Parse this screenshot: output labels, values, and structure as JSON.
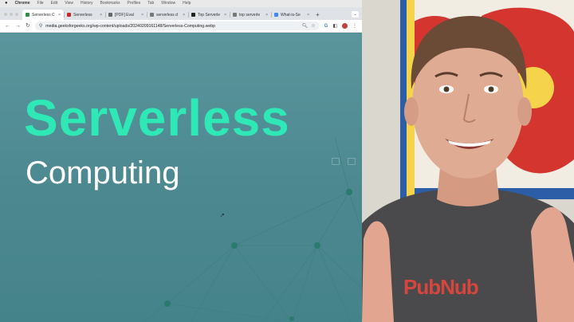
{
  "menubar": {
    "app": "Chrome",
    "items": [
      "File",
      "Edit",
      "View",
      "History",
      "Bookmarks",
      "Profiles",
      "Tab",
      "Window",
      "Help"
    ]
  },
  "tabs": [
    {
      "label": "Serverless C",
      "color": "#2f8d46",
      "active": true
    },
    {
      "label": "Serverless",
      "color": "#c62828",
      "active": false
    },
    {
      "label": "[PDF] Eval",
      "color": "#666666",
      "active": false
    },
    {
      "label": "serverless d",
      "color": "#777777",
      "active": false
    },
    {
      "label": "Top Serverle",
      "color": "#222222",
      "active": false
    },
    {
      "label": "top serverle",
      "color": "#777777",
      "active": false
    },
    {
      "label": "What-is-Se",
      "color": "#4285f4",
      "active": false
    }
  ],
  "toolbar": {
    "back": "←",
    "forward": "→",
    "reload": "↻",
    "url": "media.geeksforgeeks.org/wp-content/uploads/20240209161148/Serverless-Computing.webp"
  },
  "page": {
    "headline": "Serverless",
    "subheadline": "Computing"
  },
  "webcam": {
    "shirt_text": "PubNub"
  },
  "colors": {
    "accent": "#2ee8b5",
    "page_bg": "#4f8b92",
    "node": "#2a7a6e"
  }
}
